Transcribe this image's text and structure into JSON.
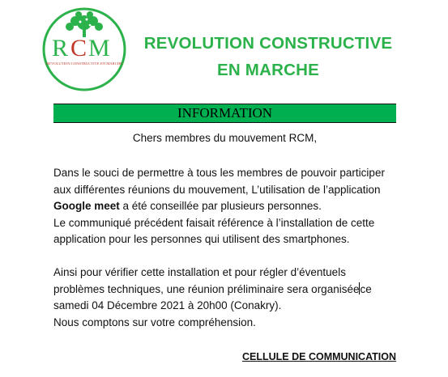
{
  "logo": {
    "letters": "RCM",
    "tagline": "REVOLUTION CONSTRUCTIVE EN MARCHE",
    "colors": {
      "green": "#2bb24a",
      "red": "#c0392b"
    }
  },
  "header": {
    "title_line1": "REVOLUTION CONSTRUCTIVE",
    "title_line2": "EN MARCHE"
  },
  "banner": {
    "label": "INFORMATION",
    "color": "#00b050"
  },
  "greeting": "Chers membres du mouvement RCM,",
  "paragraph1": {
    "l1": "Dans le souci de permettre à tous les membres de pouvoir participer",
    "l2": "aux différentes réunions du mouvement, L’utilisation de l’application",
    "l3_bold": "Google meet",
    "l3_rest": " a été conseillée par plusieurs personnes.",
    "l4": "Le communiqué précédent faisait référence à l’installation  de cette",
    "l5": "application pour les personnes qui utilisent des smartphones."
  },
  "paragraph2": {
    "l1": "Ainsi pour vérifier cette installation  et pour régler d’éventuels",
    "l2a": "problèmes techniques, une réunion préliminaire sera organisée",
    "l2b": "ce",
    "l3": "samedi 04  Décembre 2021  à 20h00  (Conakry).",
    "l4": "Nous comptons sur votre compréhension."
  },
  "signature": "CELLULE DE COMMUNICATION"
}
